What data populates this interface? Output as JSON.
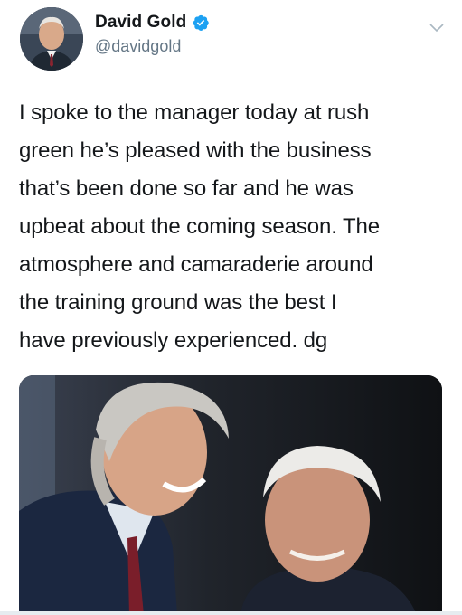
{
  "author": {
    "display_name": "David Gold",
    "handle": "@davidgold",
    "verified": true,
    "avatar_icon": "profile-photo-avatar"
  },
  "tweet": {
    "text": "I spoke to the manager today at rush\ngreen he’s pleased with the business\nthat’s been done so far and he was\nupbeat about the coming season. The\natmosphere and camaraderie around\nthe training ground was the best I\nhave previously experienced. dg"
  },
  "media": {
    "type": "photo",
    "content": "two men smiling at each other"
  },
  "icons": {
    "verified": "verified-badge-icon",
    "more": "chevron-down-icon"
  },
  "colors": {
    "text": "#14171a",
    "secondary": "#657786",
    "verified_blue": "#1da1f2"
  }
}
